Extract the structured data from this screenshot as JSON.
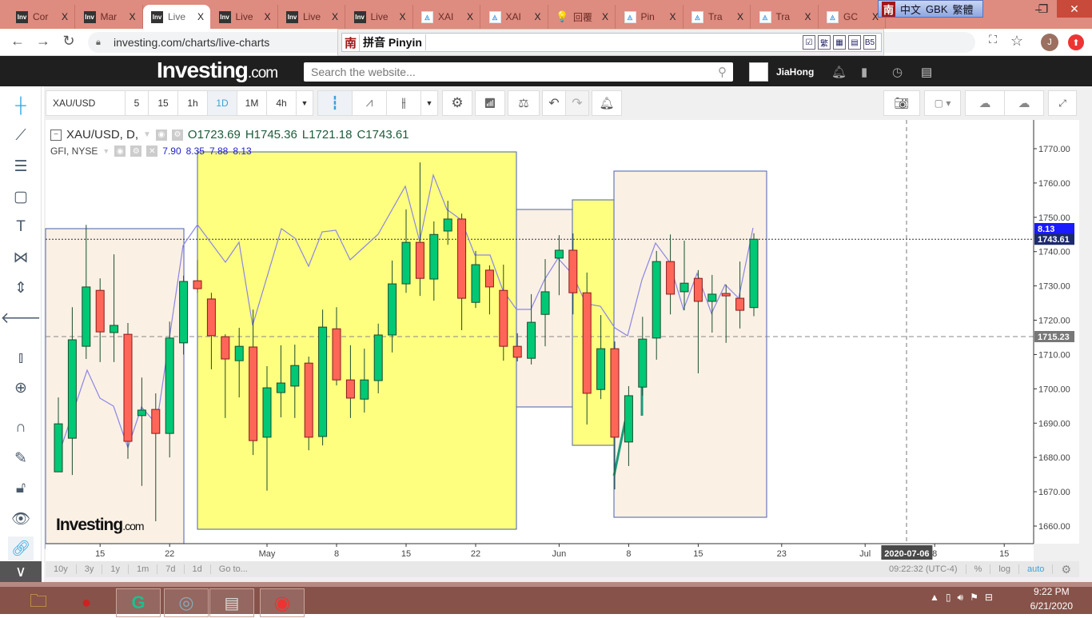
{
  "browser": {
    "tabs": [
      {
        "label": "Cor",
        "icon": "investing"
      },
      {
        "label": "Mar",
        "icon": "investing"
      },
      {
        "label": "Live",
        "icon": "investing",
        "active": true
      },
      {
        "label": "Live",
        "icon": "investing"
      },
      {
        "label": "Live",
        "icon": "investing"
      },
      {
        "label": "Live",
        "icon": "investing"
      },
      {
        "label": "XAI",
        "icon": "tradingview"
      },
      {
        "label": "XAI",
        "icon": "tradingview"
      },
      {
        "label": "回覆",
        "icon": "bulb"
      },
      {
        "label": "Pin",
        "icon": "tradingview"
      },
      {
        "label": "Tra",
        "icon": "tradingview"
      },
      {
        "label": "Tra",
        "icon": "tradingview"
      },
      {
        "label": "GC",
        "icon": "tradingview"
      }
    ],
    "tab_close": "X",
    "ime_bar": {
      "nan": "南",
      "lang": "中文",
      "gbk": "GBK",
      "trad": "繁體"
    },
    "url": "investing.com/charts/live-charts",
    "ime_input": {
      "nan": "南",
      "label": "拼音 Pinyin",
      "icons": [
        "☑",
        "繁",
        "▦",
        "▤",
        "B5"
      ]
    },
    "avatar_letter": "J"
  },
  "site": {
    "logo": "Investing",
    "logo_suffix": ".com",
    "search_placeholder": "Search the website...",
    "username": "JiaHong"
  },
  "chart_toolbar": {
    "symbol": "XAU/USD",
    "intervals": [
      "5",
      "15",
      "1h",
      "1D",
      "1M",
      "4h"
    ],
    "selected_interval": "1D"
  },
  "legend": {
    "symbol": "XAU/USD, D,",
    "open": "O1723.69",
    "high": "H1745.36",
    "low": "L1721.18",
    "close": "C1743.61",
    "compare": "GFI, NYSE",
    "compare_values": [
      "7.90",
      "8.35",
      "7.88",
      "8.13"
    ]
  },
  "watermark": {
    "main": "Investing",
    "suffix": ".com"
  },
  "bottom_bar": {
    "ranges": [
      "10y",
      "3y",
      "1y",
      "1m",
      "7d",
      "1d",
      "Go to..."
    ],
    "time": "09:22:32 (UTC-4)",
    "options": [
      "%",
      "log",
      "auto"
    ]
  },
  "taskbar": {
    "time": "9:22 PM",
    "date": "6/21/2020"
  },
  "colors": {
    "up": "#00c875",
    "down": "#ff6658",
    "yellow": "#ffff7f",
    "peach": "#fbf0e4",
    "box_border": "#4a5fb0"
  },
  "chart_data": {
    "type": "candlestick",
    "symbol": "XAU/USD",
    "interval": "D",
    "ylim": [
      1655,
      1775
    ],
    "y_ticks": [
      "1660.00",
      "1670.00",
      "1680.00",
      "1690.00",
      "1700.00",
      "1710.00",
      "1720.00",
      "1730.00",
      "1740.00",
      "1750.00",
      "1760.00",
      "1770.00"
    ],
    "x_ticks": [
      {
        "label": "15",
        "index": 3
      },
      {
        "label": "22",
        "index": 8
      },
      {
        "label": "May",
        "index": 15
      },
      {
        "label": "8",
        "index": 20
      },
      {
        "label": "15",
        "index": 25
      },
      {
        "label": "22",
        "index": 30
      },
      {
        "label": "Jun",
        "index": 36
      },
      {
        "label": "8",
        "index": 41
      },
      {
        "label": "15",
        "index": 46
      },
      {
        "label": "23",
        "index": 52
      },
      {
        "label": "Jul",
        "index": 58
      },
      {
        "label": "8",
        "index": 63
      },
      {
        "label": "15",
        "index": 68
      }
    ],
    "crosshair_date": {
      "label": "2020-07-06",
      "index": 61
    },
    "price_labels": [
      {
        "label": "8.13",
        "value": 1746.7,
        "color": "#1a1aff"
      },
      {
        "label": "1743.61",
        "value": 1743.61,
        "color": "#1c2a6e"
      },
      {
        "label": "1715.23",
        "value": 1715.23,
        "color": "#777777"
      }
    ],
    "candles": [
      [
        1675.8,
        1697.5,
        1675.8,
        1689.8
      ],
      [
        1685.6,
        1723.8,
        1674.9,
        1714.3
      ],
      [
        1712.4,
        1747.8,
        1708.7,
        1729.7
      ],
      [
        1728.7,
        1732.2,
        1707.8,
        1716.6
      ],
      [
        1716.4,
        1739.2,
        1707.8,
        1718.5
      ],
      [
        1715.9,
        1719.2,
        1679.6,
        1684.7
      ],
      [
        1692.2,
        1703.3,
        1671.7,
        1693.8
      ],
      [
        1694.0,
        1698.7,
        1661.4,
        1687.0
      ],
      [
        1687.0,
        1719.6,
        1680.0,
        1714.8
      ],
      [
        1713.4,
        1733.0,
        1710.0,
        1731.3
      ],
      [
        1731.5,
        1737.6,
        1728.0,
        1729.2
      ],
      [
        1726.2,
        1728.0,
        1705.7,
        1715.5
      ],
      [
        1715.2,
        1715.9,
        1691.5,
        1708.7
      ],
      [
        1708.2,
        1717.8,
        1697.5,
        1712.4
      ],
      [
        1712.2,
        1723.1,
        1680.7,
        1684.9
      ],
      [
        1685.9,
        1706.6,
        1670.3,
        1700.3
      ],
      [
        1698.9,
        1712.7,
        1691.7,
        1701.7
      ],
      [
        1700.8,
        1712.9,
        1691.5,
        1706.8
      ],
      [
        1707.5,
        1709.4,
        1682.1,
        1685.9
      ],
      [
        1686.1,
        1723.1,
        1683.5,
        1718.0
      ],
      [
        1717.5,
        1723.8,
        1701.0,
        1702.6
      ],
      [
        1702.6,
        1712.7,
        1691.5,
        1697.3
      ],
      [
        1697.0,
        1711.7,
        1693.1,
        1702.6
      ],
      [
        1702.4,
        1719.0,
        1698.7,
        1715.7
      ],
      [
        1715.7,
        1737.4,
        1710.6,
        1730.6
      ],
      [
        1730.6,
        1752.3,
        1728.0,
        1742.7
      ],
      [
        1742.7,
        1766.0,
        1727.1,
        1732.2
      ],
      [
        1732.0,
        1748.8,
        1725.7,
        1745.0
      ],
      [
        1746.0,
        1754.8,
        1742.0,
        1749.5
      ],
      [
        1749.5,
        1751.1,
        1717.1,
        1726.4
      ],
      [
        1725.2,
        1740.2,
        1723.6,
        1736.2
      ],
      [
        1734.6,
        1736.0,
        1721.7,
        1729.7
      ],
      [
        1728.7,
        1736.2,
        1708.2,
        1712.4
      ],
      [
        1712.4,
        1716.2,
        1708.0,
        1709.2
      ],
      [
        1708.9,
        1727.6,
        1707.1,
        1719.4
      ],
      [
        1721.7,
        1737.8,
        1712.4,
        1728.3
      ],
      [
        1738.1,
        1744.8,
        1727.3,
        1740.4
      ],
      [
        1740.4,
        1745.3,
        1721.7,
        1728.0
      ],
      [
        1728.0,
        1733.9,
        1689.6,
        1698.7
      ],
      [
        1699.8,
        1721.5,
        1697.0,
        1711.7
      ],
      [
        1711.7,
        1713.8,
        1670.7,
        1685.9
      ],
      [
        1684.5,
        1700.8,
        1677.5,
        1698.0
      ],
      [
        1700.5,
        1721.0,
        1698.0,
        1714.5
      ],
      [
        1714.8,
        1740.2,
        1708.5,
        1737.1
      ],
      [
        1737.1,
        1745.0,
        1721.7,
        1727.6
      ],
      [
        1728.3,
        1743.2,
        1722.9,
        1730.8
      ],
      [
        1732.2,
        1734.6,
        1704.5,
        1725.5
      ],
      [
        1725.5,
        1733.2,
        1716.4,
        1727.6
      ],
      [
        1727.8,
        1730.4,
        1713.4,
        1727.1
      ],
      [
        1726.4,
        1737.1,
        1717.6,
        1722.9
      ],
      [
        1723.69,
        1745.36,
        1721.18,
        1743.61
      ]
    ]
  }
}
